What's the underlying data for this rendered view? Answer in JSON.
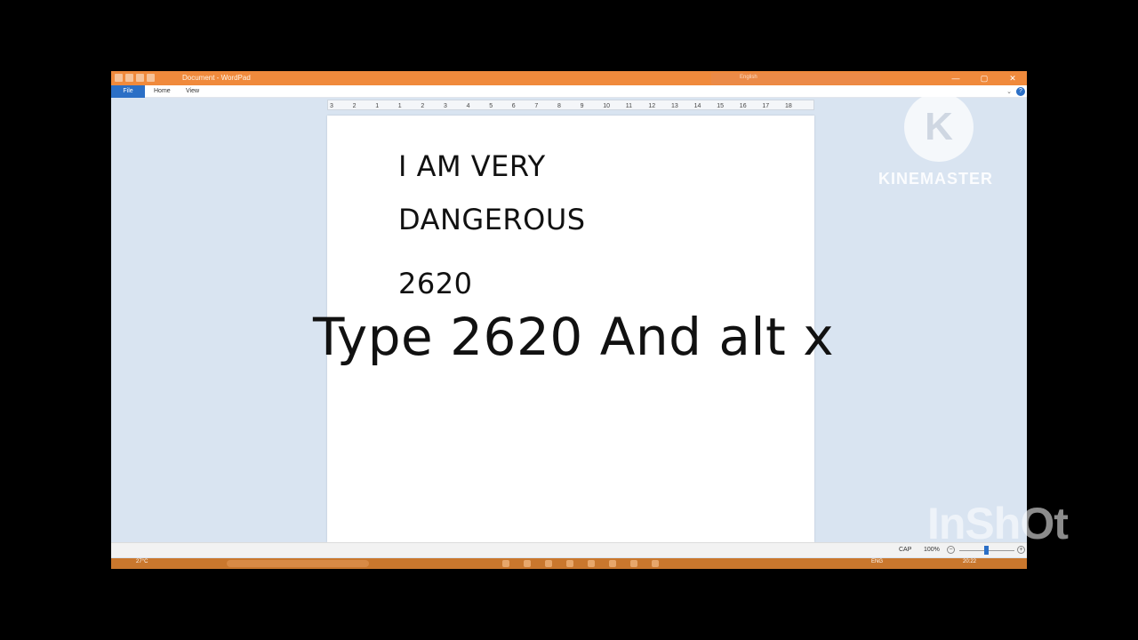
{
  "app": {
    "window_title": "Document - WordPad",
    "tray_language": "English",
    "controls": {
      "minimize": "—",
      "maximize": "▢",
      "close": "✕"
    }
  },
  "ribbon": {
    "tabs": [
      "File",
      "Home",
      "View"
    ],
    "minimize_glyph": "⌄",
    "help_glyph": "?"
  },
  "ruler": {
    "ticks": [
      "3",
      "2",
      "1",
      "1",
      "2",
      "3",
      "4",
      "5",
      "6",
      "7",
      "8",
      "9",
      "10",
      "11",
      "12",
      "13",
      "14",
      "15",
      "16",
      "17",
      "18"
    ]
  },
  "document": {
    "lines": [
      "I AM VERY",
      "DANGEROUS",
      "2620"
    ]
  },
  "status": {
    "caps": "CAP",
    "zoom": "100%",
    "zoom_out": "−",
    "zoom_in": "+",
    "zoom_level": 0.5
  },
  "taskbar": {
    "weather": "27°C",
    "language": "ENG",
    "clock": "20:22"
  },
  "overlay": {
    "caption": "Type 2620 And alt  x",
    "kinemaster_letter": "K",
    "kinemaster_text": "KINEMASTER",
    "inshot_text": "InShOt"
  },
  "colors": {
    "titlebar": "#f08a3c",
    "file_tab": "#2b6fc6",
    "workspace": "#d9e4f1"
  }
}
